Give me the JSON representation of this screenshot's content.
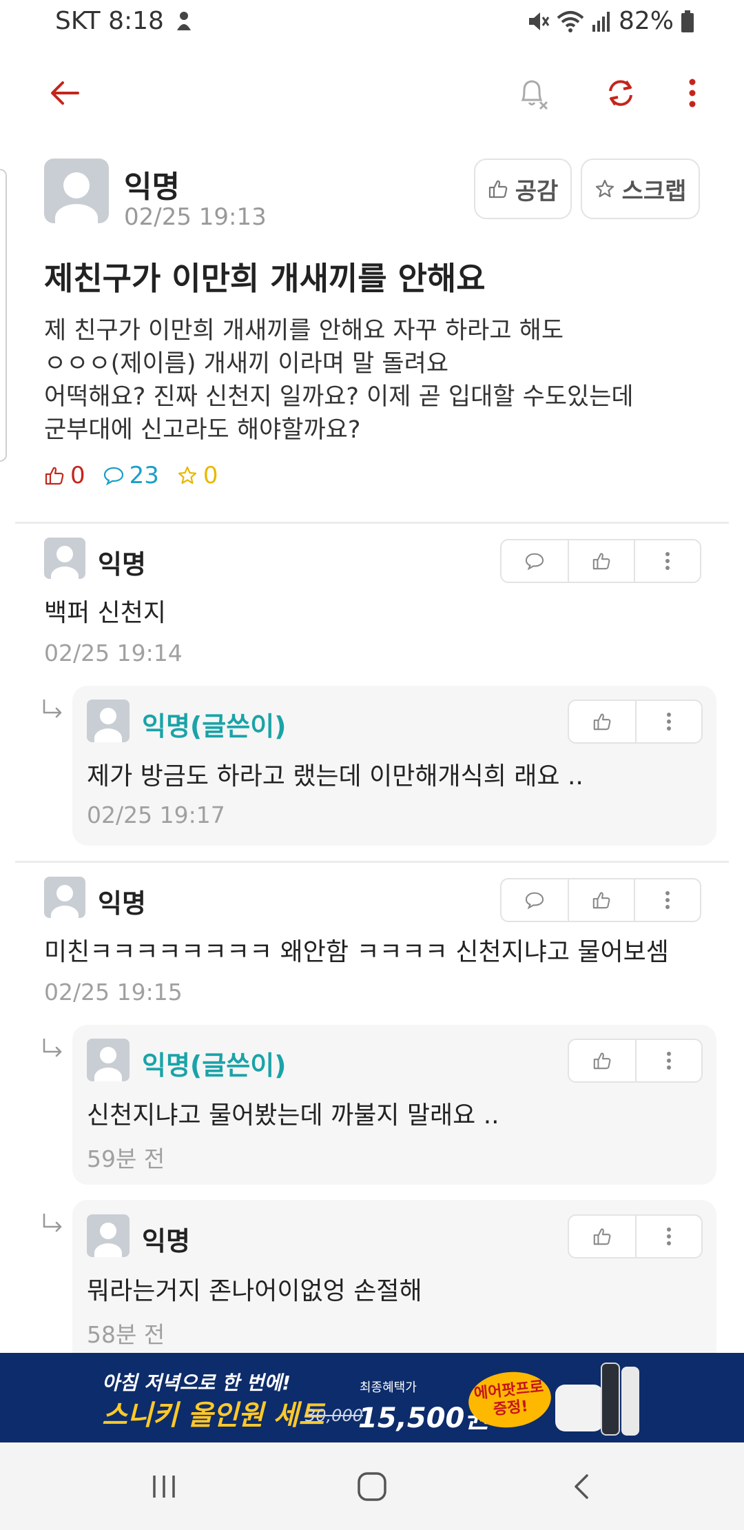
{
  "status": {
    "carrier_time": "SKT 8:18",
    "battery": "82%"
  },
  "post": {
    "author": "익명",
    "date": "02/25 19:13",
    "like_label": "공감",
    "scrap_label": "스크랩",
    "title": "제친구가 이만희 개새끼를 안해요",
    "body_lines": [
      "제 친구가 이만희 개새끼를 안해요 자꾸 하라고 해도",
      "ㅇㅇㅇ(제이름) 개새끼 이라며 말 돌려요",
      "어떡해요? 진짜 신천지 일까요? 이제 곧 입대할 수도있는데",
      "군부대에 신고라도 해야할까요?"
    ],
    "likes": "0",
    "comments": "23",
    "scraps": "0"
  },
  "comments": [
    {
      "author": "익명",
      "text": "백퍼 신천지",
      "date": "02/25 19:14"
    },
    {
      "author": "익명(글쓴이)",
      "text": "제가 방금도 하라고 랬는데 이만해개식희 래요 ..",
      "date": "02/25 19:17"
    },
    {
      "author": "익명",
      "text": "미친ㅋㅋㅋㅋㅋㅋㅋㅋ 왜안함 ㅋㅋㅋㅋ 신천지냐고 물어보셈",
      "date": "02/25 19:15"
    },
    {
      "author": "익명(글쓴이)",
      "text": "신천지냐고 물어봤는데 까불지 말래요 ..",
      "date": "59분 전"
    },
    {
      "author": "익명",
      "text": "뭐라는거지 존나어이없엉 손절해",
      "date": "58분 전"
    }
  ],
  "ad": {
    "line1": "아침 저녁으로 한 번에!",
    "line2": "스니키 올인원 세트",
    "benefit": "최종혜택가",
    "old_price": "30,000",
    "price": "15,500원",
    "badge_line1": "에어팟프로",
    "badge_line2": "증정!"
  },
  "colors": {
    "accent_red": "#c4251c",
    "op_teal": "#1aa3a8",
    "comment_blue": "#1a9fc9",
    "star_yellow": "#e8b800"
  },
  "icons": {
    "back": "arrow-left-icon",
    "notifications_off": "bell-off-icon",
    "refresh": "refresh-icon",
    "more": "more-vertical-icon"
  }
}
